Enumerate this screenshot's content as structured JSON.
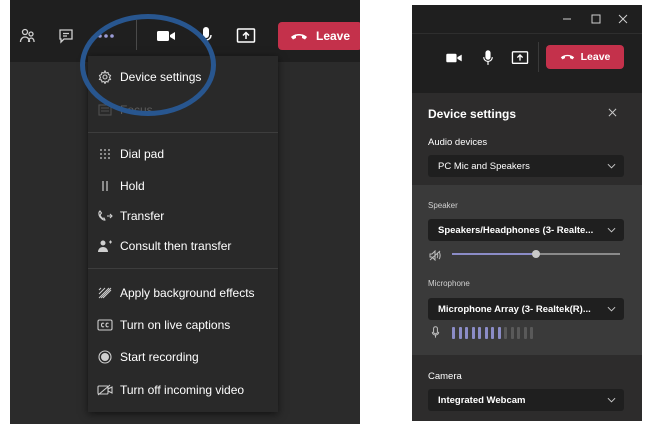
{
  "colors": {
    "leave": "#c4314b",
    "accent": "#8b8cc7",
    "highlight_circle": "#28568f",
    "panel_bg": "#2d2c2c",
    "menu_bg": "#292929"
  },
  "left": {
    "toolbar": {
      "icons": [
        "people-icon",
        "chat-icon",
        "more-options-icon",
        "camera-icon",
        "microphone-icon",
        "share-screen-icon"
      ],
      "leave_label": "Leave"
    },
    "menu": {
      "items": [
        {
          "label": "Device settings",
          "icon": "gear-icon"
        },
        {
          "label": "Focus",
          "icon": "focus-icon",
          "disabled": true
        },
        {
          "label": "Dial pad",
          "icon": "dialpad-icon"
        },
        {
          "label": "Hold",
          "icon": "pause-icon"
        },
        {
          "label": "Transfer",
          "icon": "transfer-icon"
        },
        {
          "label": "Consult then transfer",
          "icon": "consult-icon"
        },
        {
          "label": "Apply background effects",
          "icon": "background-effects-icon"
        },
        {
          "label": "Turn on live captions",
          "icon": "captions-icon"
        },
        {
          "label": "Start recording",
          "icon": "record-icon"
        },
        {
          "label": "Turn off incoming video",
          "icon": "video-off-icon"
        }
      ]
    }
  },
  "right": {
    "window_controls": [
      "minimize-icon",
      "maximize-icon",
      "close-icon"
    ],
    "toolbar": {
      "icons": [
        "camera-icon",
        "microphone-icon",
        "share-screen-icon"
      ],
      "leave_label": "Leave"
    },
    "device_settings": {
      "title": "Device settings",
      "audio_devices_label": "Audio devices",
      "audio_devices_value": "PC Mic and Speakers",
      "speaker_label": "Speaker",
      "speaker_value": "Speakers/Headphones (3- Realte...",
      "speaker_volume": 0.5,
      "microphone_label": "Microphone",
      "microphone_value": "Microphone Array (3- Realtek(R)...",
      "mic_level_bars_total": 13,
      "mic_level_bars_active": 8,
      "camera_label": "Camera",
      "camera_value": "Integrated Webcam"
    }
  }
}
